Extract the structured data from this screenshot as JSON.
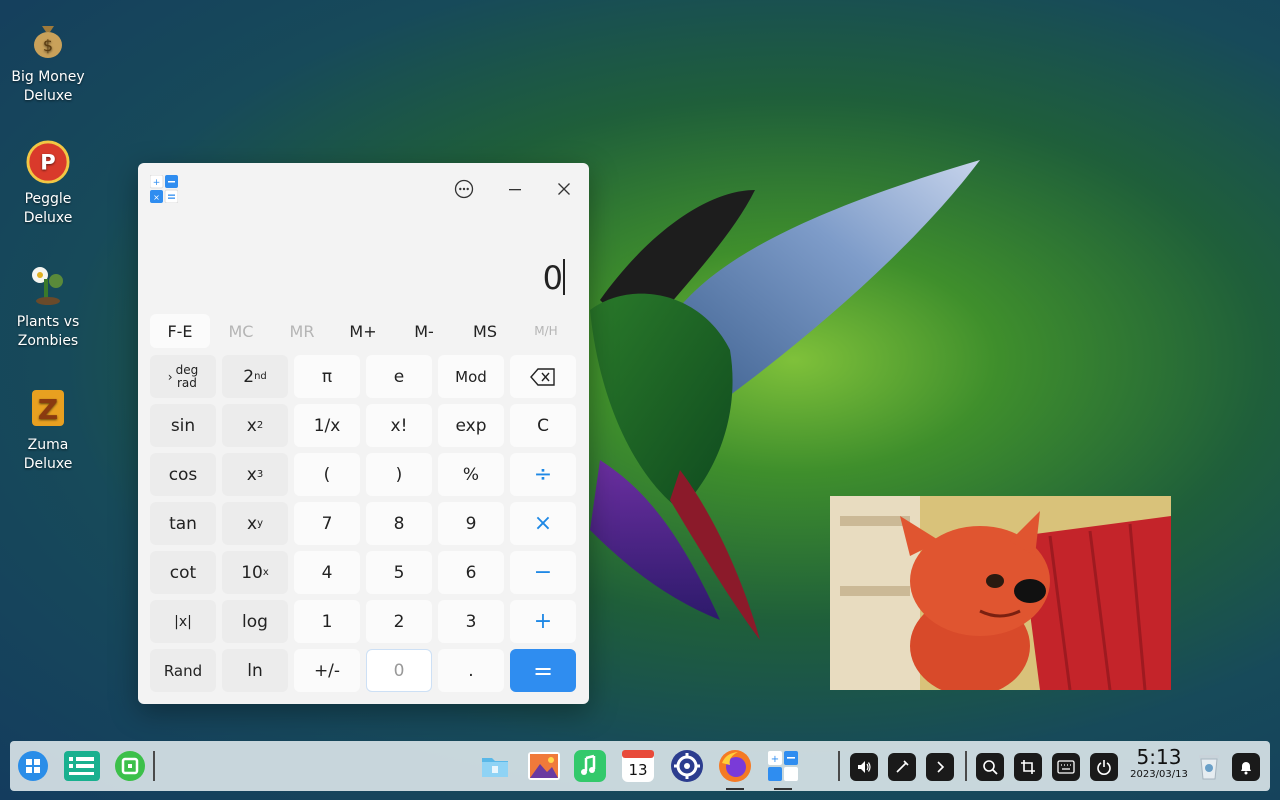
{
  "desktop": {
    "icons": [
      {
        "label": "Big Money Deluxe"
      },
      {
        "label": "Peggle Deluxe"
      },
      {
        "label": "Plants vs Zombies"
      },
      {
        "label": "Zuma Deluxe"
      }
    ]
  },
  "calculator": {
    "display_value": "0",
    "memory": [
      "F-E",
      "MC",
      "MR",
      "M+",
      "M-",
      "MS",
      "M/H"
    ],
    "keys": {
      "r1": [
        "deg rad",
        "2nd",
        "π",
        "e",
        "Mod",
        "backspace"
      ],
      "r2": [
        "sin",
        "x²",
        "1/x",
        "x!",
        "exp",
        "C"
      ],
      "r3": [
        "cos",
        "x³",
        "(",
        ")",
        "%",
        "÷"
      ],
      "r4": [
        "tan",
        "xʸ",
        "7",
        "8",
        "9",
        "×"
      ],
      "r5": [
        "cot",
        "10ˣ",
        "4",
        "5",
        "6",
        "−"
      ],
      "r6": [
        "|x|",
        "log",
        "1",
        "2",
        "3",
        "+"
      ],
      "r7": [
        "Rand",
        "ln",
        "+/-",
        "0",
        ".",
        "="
      ]
    },
    "deg": "deg",
    "rad": "rad",
    "two": "2",
    "nd": "nd",
    "x": "x",
    "sq": "2",
    "cube": "3",
    "pow_y": "y",
    "ten": "10",
    "pow_x": "x"
  },
  "taskbar": {
    "time": "5:13",
    "date": "2023/03/13",
    "calendar_day": "13"
  },
  "colors": {
    "accent": "#2f8df0"
  }
}
